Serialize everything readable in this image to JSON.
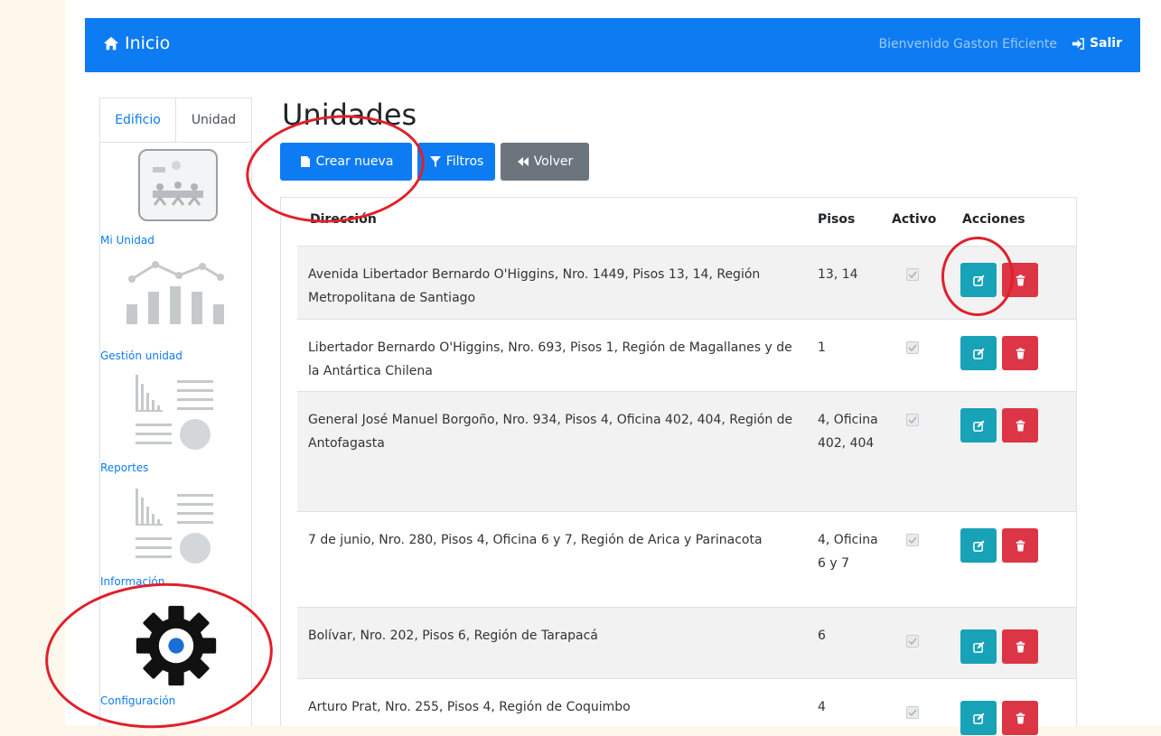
{
  "navbar": {
    "brand": "Inicio",
    "welcome": "Bienvenido Gaston Eficiente",
    "logout": "Salir"
  },
  "sidebar": {
    "tabs": [
      "Edificio",
      "Unidad"
    ],
    "items": [
      {
        "label": "Mi Unidad",
        "icon": "unit-image-icon"
      },
      {
        "label": "Gestión unidad",
        "icon": "line-bar-chart-icon"
      },
      {
        "label": "Reportes",
        "icon": "report-chart-icon"
      },
      {
        "label": "Información",
        "icon": "report-chart-icon"
      },
      {
        "label": "Configuración",
        "icon": "gear-icon"
      }
    ]
  },
  "main": {
    "title": "Unidades",
    "buttons": {
      "create": "Crear nueva",
      "filters": "Filtros",
      "back": "Volver"
    }
  },
  "table": {
    "headers": [
      "Dirección",
      "Pisos",
      "Activo",
      "Acciones"
    ],
    "rows": [
      {
        "address": "Avenida Libertador Bernardo O'Higgins, Nro. 1449, Pisos 13, 14, Región Metropolitana de Santiago",
        "pisos": "13, 14",
        "active": true
      },
      {
        "address": "Libertador Bernardo O'Higgins, Nro. 693, Pisos 1, Región de Magallanes y de la Antártica Chilena",
        "pisos": "1",
        "active": true
      },
      {
        "address": "General José Manuel Borgoño, Nro. 934, Pisos 4, Oficina 402, 404, Región de Antofagasta",
        "pisos": "4, Oficina 402, 404",
        "active": true
      },
      {
        "address": "7 de junio, Nro. 280, Pisos 4, Oficina 6 y 7, Región de Arica y Parinacota",
        "pisos": "4, Oficina 6 y 7",
        "active": true
      },
      {
        "address": "Bolívar, Nro. 202, Pisos 6, Región de Tarapacá",
        "pisos": "6",
        "active": true
      },
      {
        "address": "Arturo Prat, Nro. 255, Pisos 4, Región de Coquimbo",
        "pisos": "4",
        "active": true
      }
    ]
  },
  "colors": {
    "primary": "#0d7cf2",
    "info": "#17a2b8",
    "danger": "#dc3545",
    "secondary": "#6c757d",
    "annotation": "#e0202a"
  }
}
